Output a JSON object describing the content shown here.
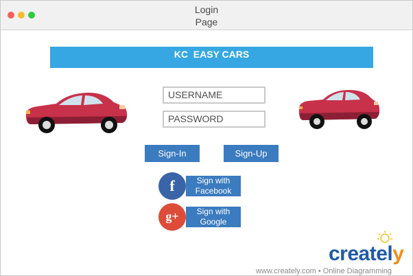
{
  "window": {
    "title_line1": "Login",
    "title_line2": "Page"
  },
  "banner": {
    "text": "KC  EASY CARS"
  },
  "form": {
    "username_placeholder": "USERNAME",
    "password_placeholder": "PASSWORD",
    "signin_label": "Sign-In",
    "signup_label": "Sign-Up"
  },
  "social": {
    "facebook_label_line1": "Sign with",
    "facebook_label_line2": "Facebook",
    "facebook_glyph": "f",
    "google_label_line1": "Sign with",
    "google_label_line2": "Google",
    "google_glyph": "g+"
  },
  "footer": {
    "url": "www.creately.com • Online Diagramming",
    "logo_main": "createl",
    "logo_end": "y"
  },
  "colors": {
    "banner": "#36a7e2",
    "button": "#3b7bbf",
    "facebook": "#3a64a8",
    "google": "#dd4b39",
    "car_body": "#c8314a"
  },
  "icons": [
    "car-icon",
    "facebook-icon",
    "google-plus-icon",
    "lightbulb-icon"
  ]
}
